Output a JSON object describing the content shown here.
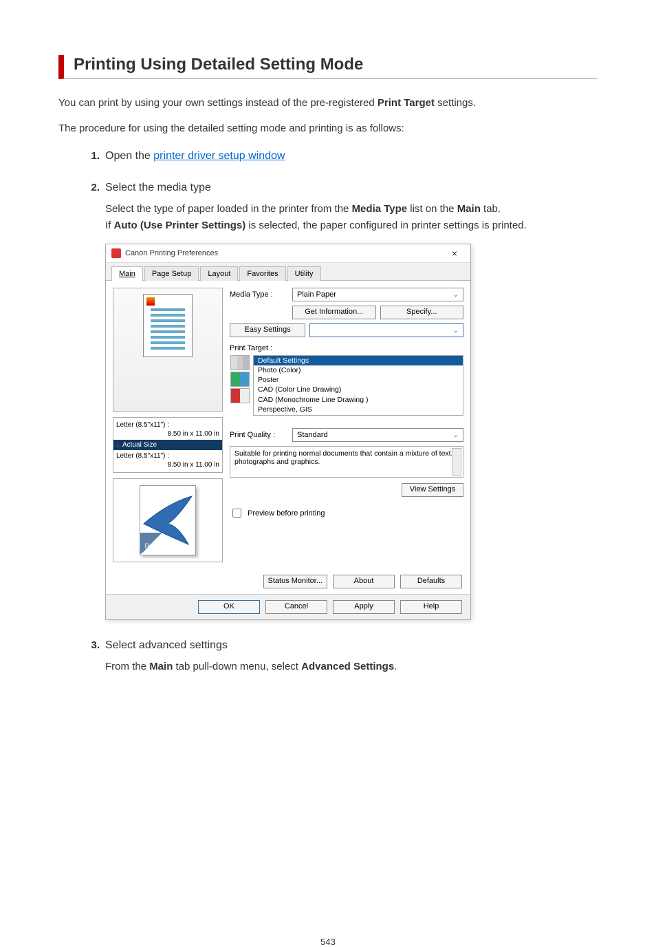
{
  "title": "Printing Using Detailed Setting Mode",
  "intro1_pre": "You can print by using your own settings instead of the pre-registered ",
  "intro1_bold": "Print Target",
  "intro1_post": " settings.",
  "intro2": "The procedure for using the detailed setting mode and printing is as follows:",
  "steps": {
    "s1": {
      "num": "1.",
      "pre": "Open the ",
      "link": "printer driver setup window"
    },
    "s2": {
      "num": "2.",
      "title": "Select the media type",
      "line1_pre": "Select the type of paper loaded in the printer from the ",
      "line1_b1": "Media Type",
      "line1_mid": " list on the ",
      "line1_b2": "Main",
      "line1_post": " tab.",
      "line2_pre": "If ",
      "line2_b": "Auto (Use Printer Settings)",
      "line2_post": " is selected, the paper configured in printer settings is printed."
    },
    "s3": {
      "num": "3.",
      "title": "Select advanced settings",
      "line_pre": "From the ",
      "line_b1": "Main",
      "line_mid": " tab pull-down menu, select ",
      "line_b2": "Advanced Settings",
      "line_post": "."
    }
  },
  "dialog": {
    "title": "Canon           Printing Preferences",
    "close": "×",
    "tabs": [
      "Main",
      "Page Setup",
      "Layout",
      "Favorites",
      "Utility"
    ],
    "size1a": "Letter (8.5\"x11\") :",
    "size1b": "8.50 in x 11.00 in",
    "actual": "Actual Size",
    "size2a": "Letter (8.5\"x11\") :",
    "size2b": "8.50 in x 11.00 in",
    "media_lbl": "Media Type :",
    "media_val": "Plain Paper",
    "get_info": "Get Information...",
    "specify": "Specify...",
    "easy_lbl": "Easy Settings",
    "pt_lbl": "Print Target :",
    "pt_sel": "Default Settings",
    "pt_items": [
      "Photo (Color)",
      "Poster",
      "CAD (Color Line Drawing)",
      "CAD (Monochrome Line Drawing )",
      "Perspective, GIS"
    ],
    "pq_lbl": "Print Quality :",
    "pq_val": "Standard",
    "desc": "Suitable for printing normal documents that contain a mixture of text, photographs and graphics.",
    "view_btn": "View Settings",
    "preview_chk": "Preview before printing",
    "status": "Status Monitor...",
    "about": "About",
    "defaults": "Defaults",
    "ok": "OK",
    "cancel": "Cancel",
    "apply": "Apply",
    "help": "Help",
    "thumb_letter": "R"
  },
  "page_number": "543"
}
